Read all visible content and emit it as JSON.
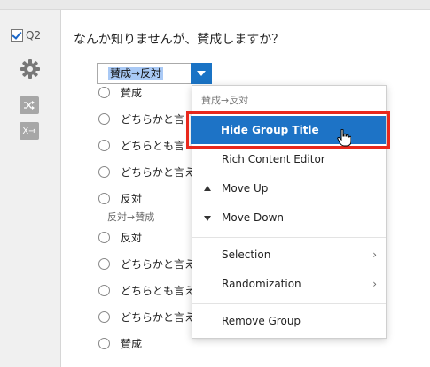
{
  "question": {
    "number": "Q2",
    "text": "なんか知りませんが、賛成しますか？"
  },
  "sidebar": {
    "shuffle_icon": "shuffle-icon",
    "xarrow_label": "X→"
  },
  "group_select": {
    "value": "賛成→反対"
  },
  "choices_group1": [
    "賛成",
    "どちらかと言",
    "どちらとも言",
    "どちらかと言え",
    "反対"
  ],
  "group2_label": "反対→賛成",
  "choices_group2": [
    "反対",
    "どちらかと言え",
    "どちらとも言え",
    "どちらかと言え",
    "賛成"
  ],
  "menu": {
    "header": "賛成→反対",
    "items": {
      "hide_group_title": "Hide Group Title",
      "rich_content_editor": "Rich Content Editor",
      "move_up": "Move Up",
      "move_down": "Move Down",
      "selection": "Selection",
      "randomization": "Randomization",
      "remove_group": "Remove Group"
    },
    "submenu_chevron": "›"
  },
  "colors": {
    "accent": "#1d73c6",
    "highlight_border": "#e8281c"
  }
}
